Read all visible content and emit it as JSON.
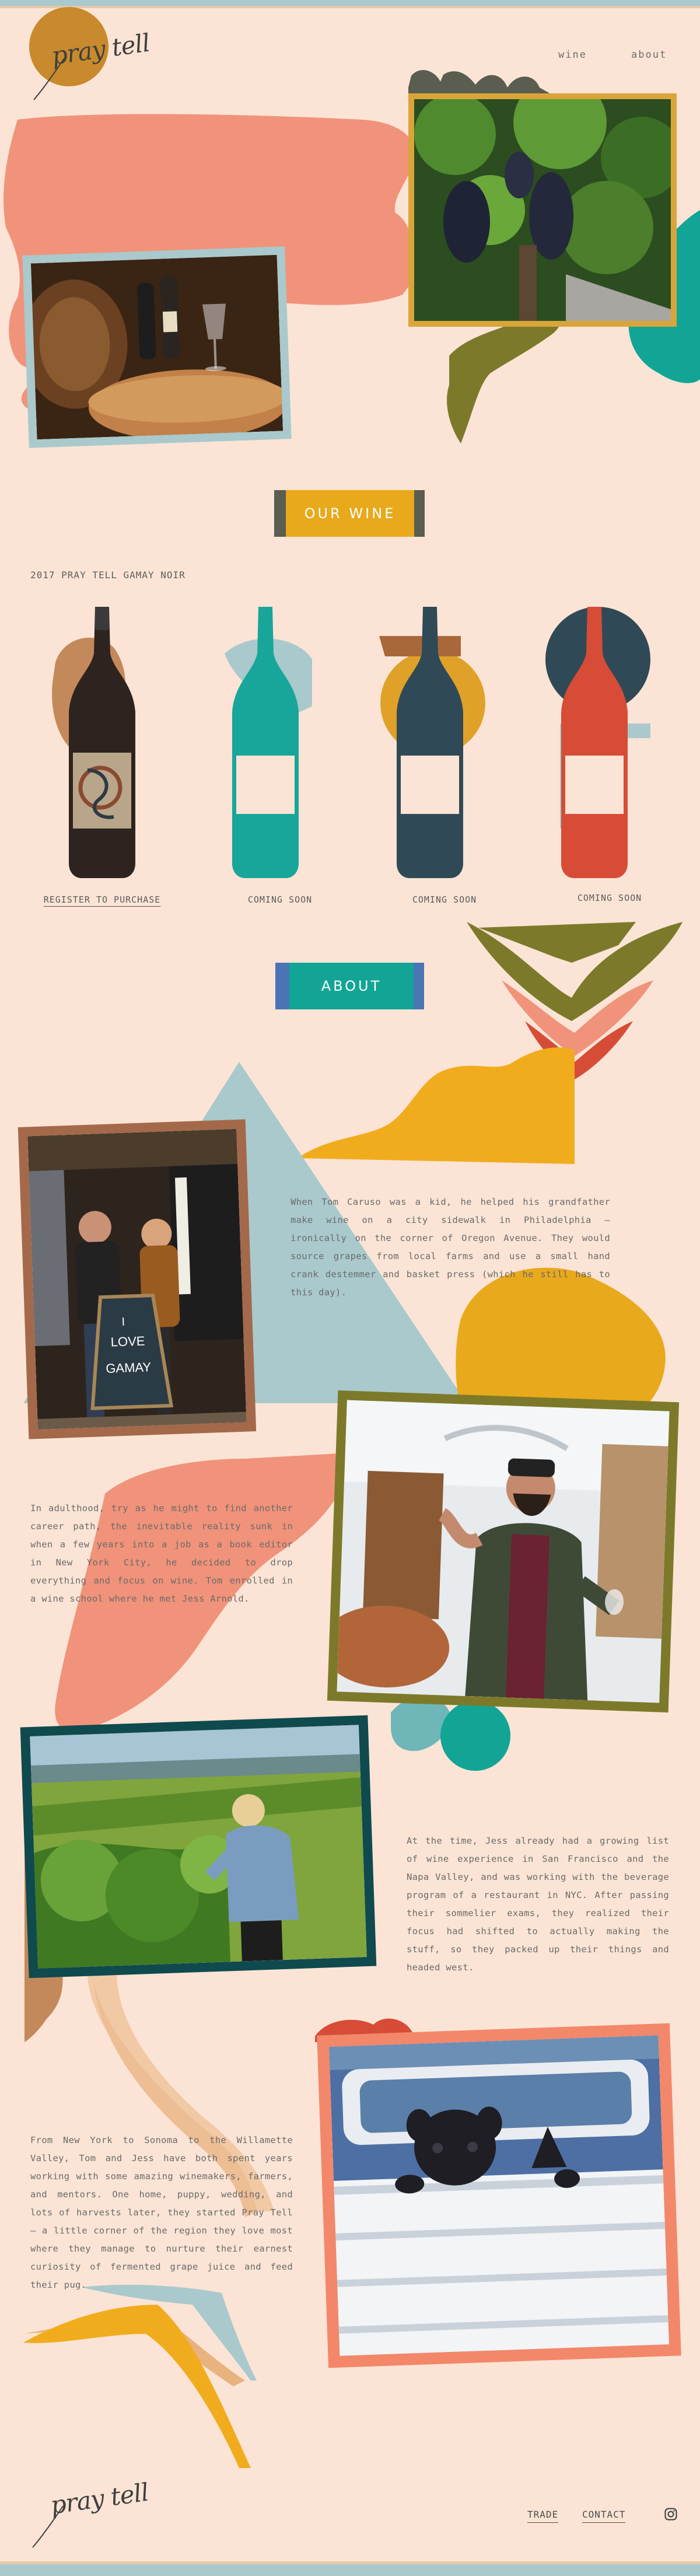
{
  "header": {
    "logo": "pray tell",
    "nav": [
      {
        "label": "wine"
      },
      {
        "label": "about"
      }
    ]
  },
  "sections": {
    "wine_tag": "OUR WINE",
    "about_tag": "ABOUT"
  },
  "wine": {
    "heading": "2017 PRAY TELL GAMAY NOIR",
    "bottles": [
      {
        "cta": "REGISTER TO PURCHASE",
        "color": "#2d2420"
      },
      {
        "cta": "COMING SOON",
        "color": "#18a69a"
      },
      {
        "cta": "COMING SOON",
        "color": "#2f4a56"
      },
      {
        "cta": "COMING SOON",
        "color": "#d74c36"
      }
    ]
  },
  "about": {
    "paragraphs": [
      "When Tom Caruso was a kid, he helped his grandfather make wine on a city sidewalk in Philadelphia — ironically on the corner of Oregon Avenue. They would source grapes from local farms and use a small hand crank destemmer and basket press (which he still has to this day).",
      "In adulthood, try as he might to find another career path, the inevitable reality sunk in when a few years into a job as a book editor in New York City, he decided to drop everything and focus on wine. Tom enrolled in a wine school where he met Jess Arnold.",
      "At the time, Jess already had a growing list of wine experience in San Francisco and the Napa Valley, and was working with the beverage program of a restaurant in NYC. After passing their sommelier exams, they realized their focus had shifted to actually making the stuff, so they packed up their things and headed west.",
      "From New York to Sonoma to the Willamette Valley, Tom and Jess have both spent years working with some amazing winemakers, farmers, and mentors. One home, puppy, wedding, and lots of harvests later, they started Pray Tell — a little corner of the region they love most where they manage to nurture their earnest curiosity of fermented grape juice and feed their pug."
    ],
    "chalkboard": "I LOVE GAMAY"
  },
  "footer": {
    "logo": "pray tell",
    "links": [
      {
        "label": "TRADE"
      },
      {
        "label": "CONTACT"
      }
    ],
    "instagram": "instagram-icon"
  },
  "colors": {
    "background": "#fbe4d5",
    "salmon": "#f0937a",
    "mustard": "#e8a91c",
    "olive": "#7c7a2a",
    "teal": "#12a596",
    "sky": "#a9c9cc",
    "brown": "#b07a4e"
  }
}
